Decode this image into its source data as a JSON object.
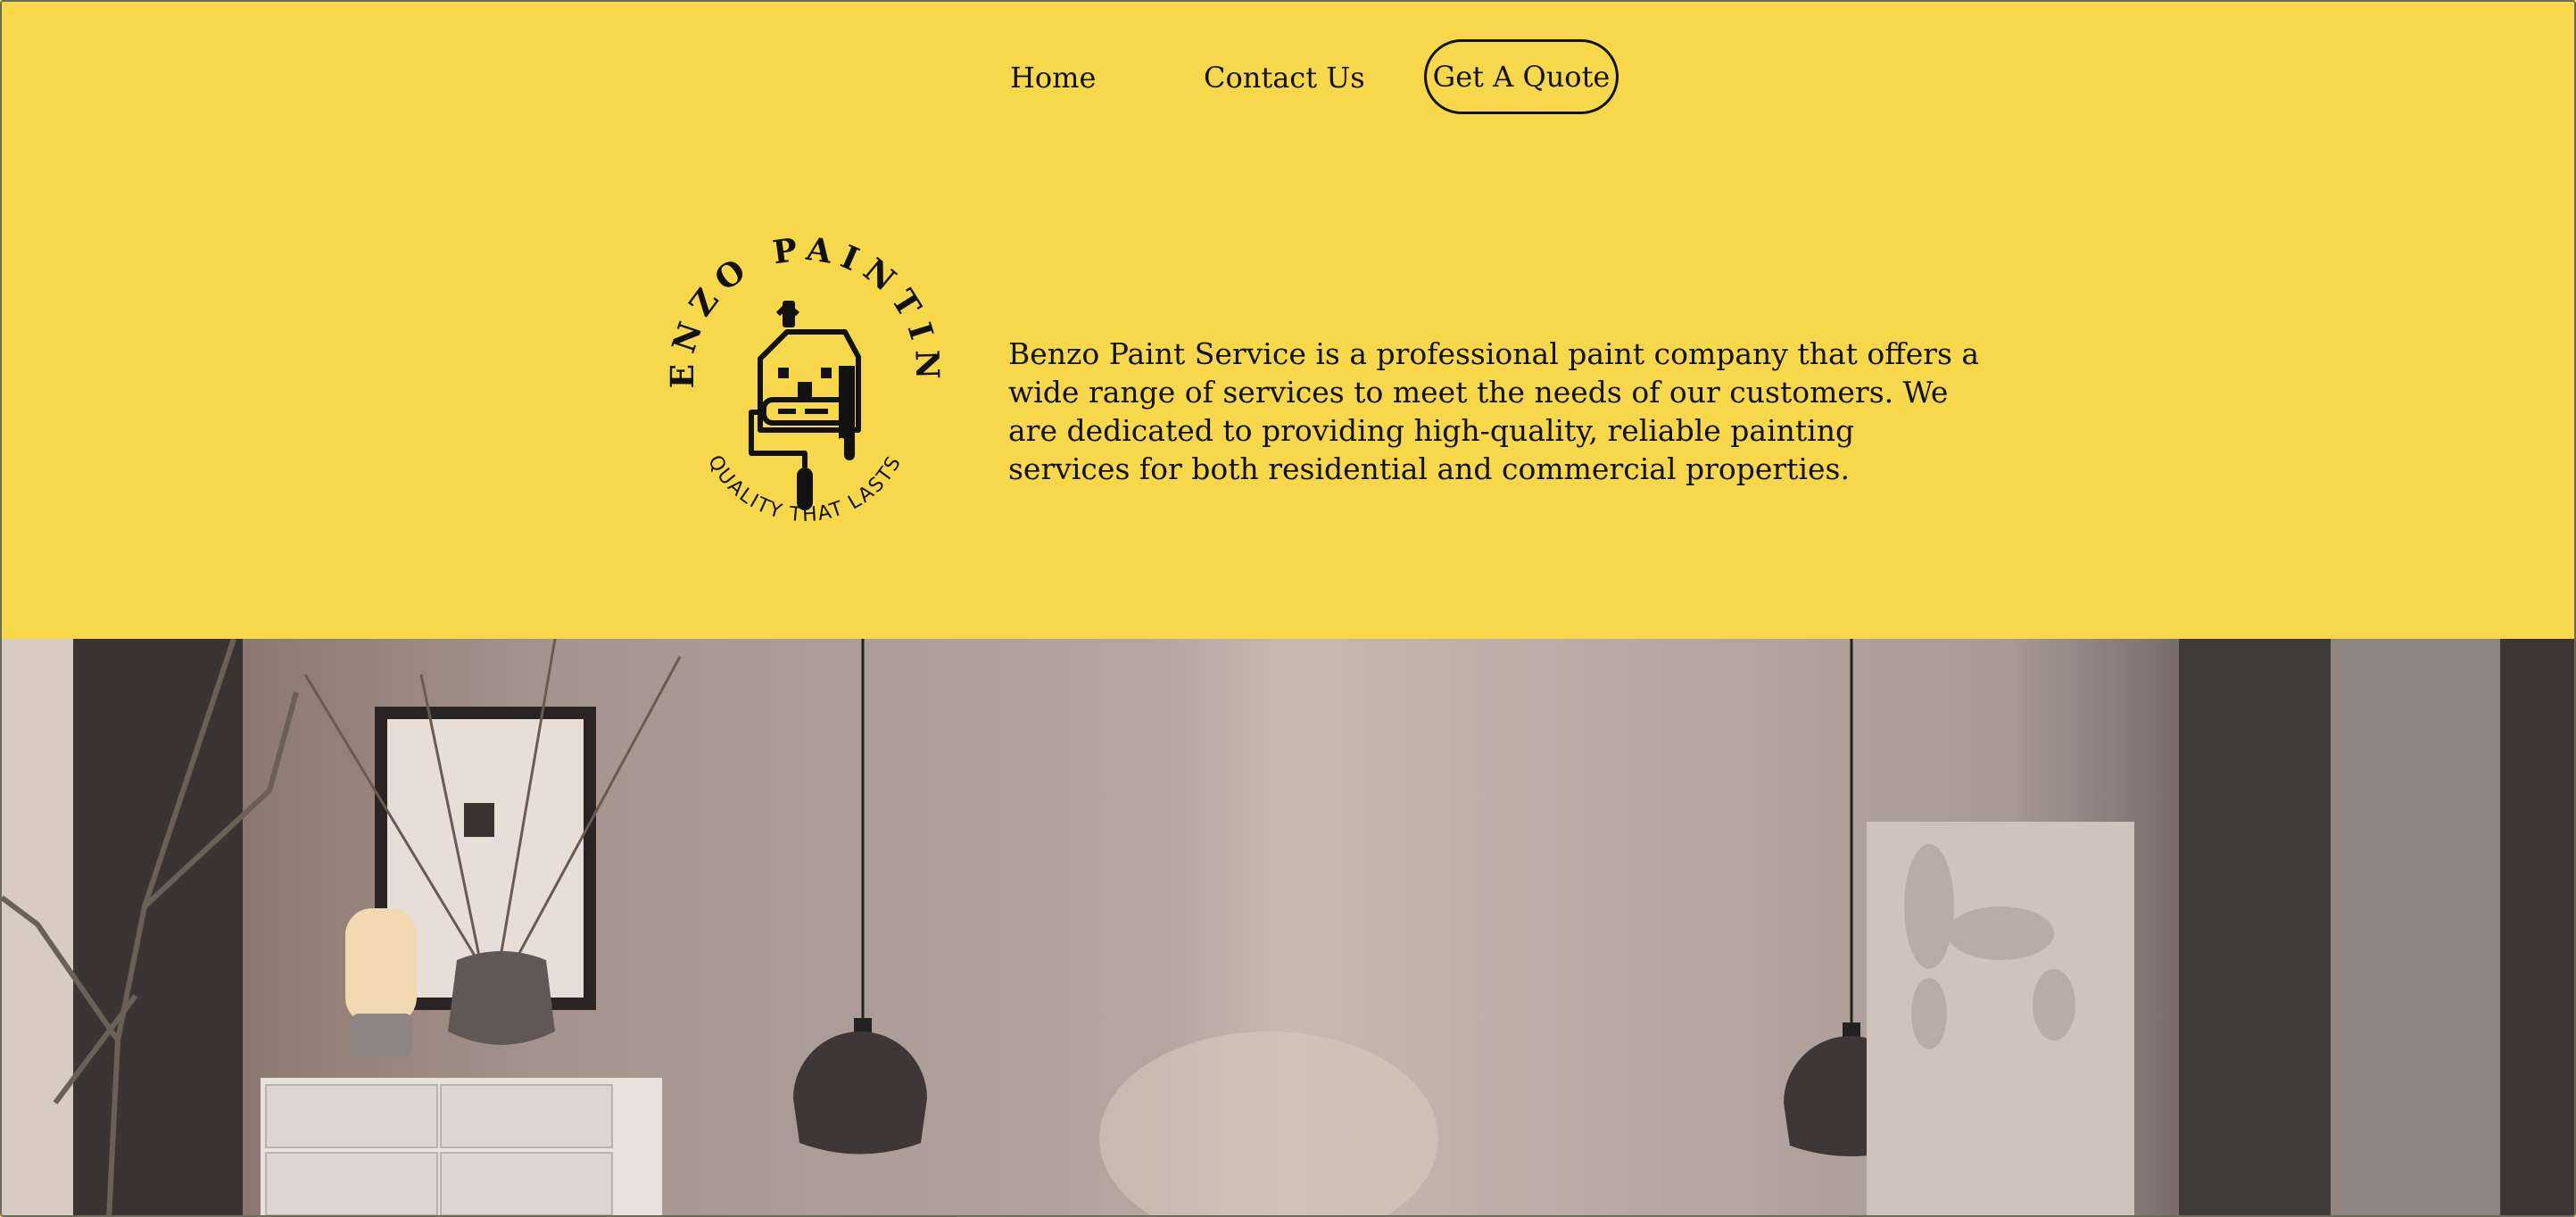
{
  "nav": {
    "home_label": "Home",
    "contact_label": "Contact Us",
    "quote_label": "Get A Quote"
  },
  "logo": {
    "top_text": "BENZO PAINTING",
    "bottom_text": "QUALITY THAT LASTS"
  },
  "intro": {
    "text": "Benzo Paint Service is a professional paint company that offers a wide range of services to meet the needs of our customers. We are dedicated to providing high-quality, reliable painting services for both residential and commercial properties."
  },
  "colors": {
    "background": "#f8d84b",
    "text": "#111111"
  },
  "hero": {
    "image_description_icon": "interior-room-photo"
  }
}
